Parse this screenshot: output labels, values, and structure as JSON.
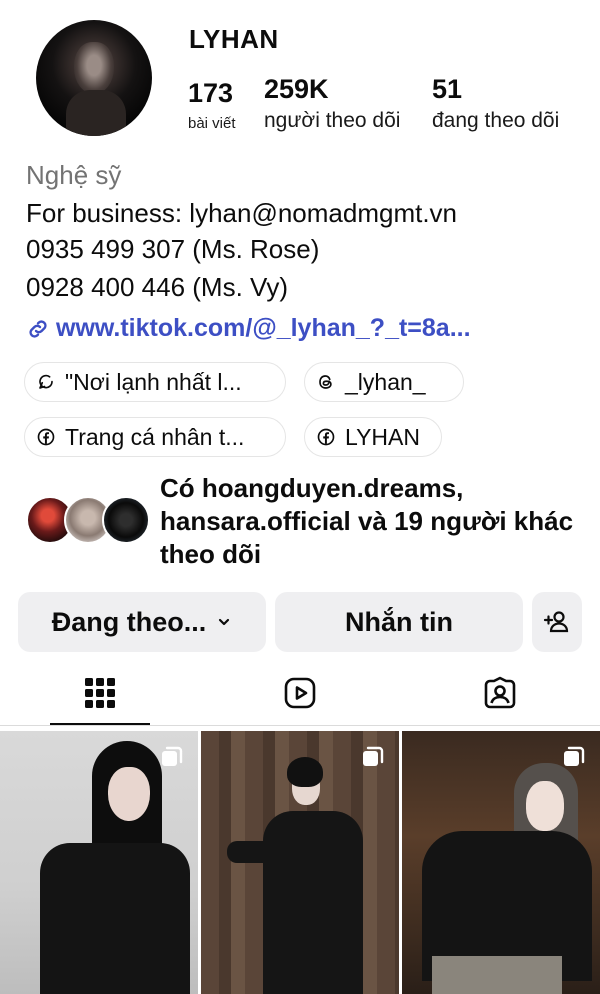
{
  "profile": {
    "username": "LYHAN",
    "stats": {
      "posts_count": "173",
      "posts_label": "bài viết",
      "followers_count": "259K",
      "followers_label": "người theo dõi",
      "following_count": "51",
      "following_label": "đang theo dõi"
    },
    "category": "Nghệ sỹ",
    "bio_lines": [
      "For business: lyhan@nomadmgmt.vn",
      "0935 499 307 (Ms. Rose)",
      "0928 400 446 (Ms. Vy)"
    ],
    "link": "www.tiktok.com/@_lyhan_?_t=8a...",
    "chips": [
      {
        "label": "\"Nơi lạnh nhất l...",
        "icon": "thread-icon"
      },
      {
        "label": "_lyhan_",
        "icon": "threads-icon"
      },
      {
        "label": "Trang cá nhân t...",
        "icon": "facebook-icon"
      },
      {
        "label": "LYHAN",
        "icon": "facebook-icon"
      }
    ],
    "mutual": {
      "prefix": "Có ",
      "names": "hoangduyen.dreams, hansara.official",
      "suffix": " và 19 người khác theo dõi"
    }
  },
  "actions": {
    "following_label": "Đang theo...",
    "message_label": "Nhắn tin",
    "add_person_icon": "add-person-icon"
  },
  "tabs": [
    {
      "name": "grid",
      "icon": "grid-icon",
      "active": true
    },
    {
      "name": "reels",
      "icon": "reels-icon",
      "active": false
    },
    {
      "name": "tagged",
      "icon": "tagged-icon",
      "active": false
    }
  ],
  "colors": {
    "link": "#3d4fc4",
    "button_bg": "#efeff1",
    "muted_text": "#737373"
  }
}
